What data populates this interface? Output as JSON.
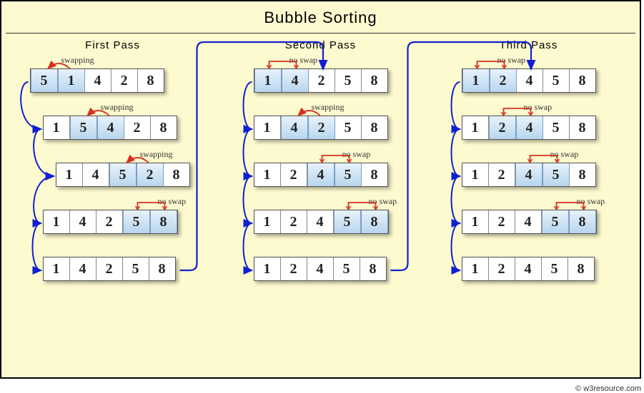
{
  "title": "Bubble  Sorting",
  "credit": "© w3resource.com",
  "passes": [
    {
      "label": "First  Pass",
      "rows": [
        {
          "values": [
            5,
            1,
            4,
            2,
            8
          ],
          "highlight": [
            0,
            1
          ],
          "annot": "swapping",
          "annotType": "swap",
          "indent": 0
        },
        {
          "values": [
            1,
            5,
            4,
            2,
            8
          ],
          "highlight": [
            1,
            2
          ],
          "annot": "swapping",
          "annotType": "swap",
          "indent": 1
        },
        {
          "values": [
            1,
            4,
            5,
            2,
            8
          ],
          "highlight": [
            2,
            3
          ],
          "annot": "swapping",
          "annotType": "swap",
          "indent": 2
        },
        {
          "values": [
            1,
            4,
            2,
            5,
            8
          ],
          "highlight": [
            3,
            4
          ],
          "annot": "no swap",
          "annotType": "noswap",
          "indent": 3
        },
        {
          "values": [
            1,
            4,
            2,
            5,
            8
          ],
          "highlight": [],
          "annot": "",
          "annotType": "none",
          "indent": 4
        }
      ]
    },
    {
      "label": "Second  Pass",
      "rows": [
        {
          "values": [
            1,
            4,
            2,
            5,
            8
          ],
          "highlight": [
            0,
            1
          ],
          "annot": "no swap",
          "annotType": "noswap"
        },
        {
          "values": [
            1,
            4,
            2,
            5,
            8
          ],
          "highlight": [
            1,
            2
          ],
          "annot": "swapping",
          "annotType": "swap"
        },
        {
          "values": [
            1,
            2,
            4,
            5,
            8
          ],
          "highlight": [
            2,
            3
          ],
          "annot": "no swap",
          "annotType": "noswap"
        },
        {
          "values": [
            1,
            2,
            4,
            5,
            8
          ],
          "highlight": [
            3,
            4
          ],
          "annot": "no swap",
          "annotType": "noswap"
        },
        {
          "values": [
            1,
            2,
            4,
            5,
            8
          ],
          "highlight": [],
          "annot": "",
          "annotType": "none"
        }
      ]
    },
    {
      "label": "Third  Pass",
      "rows": [
        {
          "values": [
            1,
            2,
            4,
            5,
            8
          ],
          "highlight": [
            0,
            1
          ],
          "annot": "no swap",
          "annotType": "noswap"
        },
        {
          "values": [
            1,
            2,
            4,
            5,
            8
          ],
          "highlight": [
            1,
            2
          ],
          "annot": "no swap",
          "annotType": "noswap"
        },
        {
          "values": [
            1,
            2,
            4,
            5,
            8
          ],
          "highlight": [
            2,
            3
          ],
          "annot": "no swap",
          "annotType": "noswap"
        },
        {
          "values": [
            1,
            2,
            4,
            5,
            8
          ],
          "highlight": [
            3,
            4
          ],
          "annot": "no swap",
          "annotType": "noswap"
        },
        {
          "values": [
            1,
            2,
            4,
            5,
            8
          ],
          "highlight": [],
          "annot": "",
          "annotType": "none"
        }
      ]
    }
  ],
  "colors": {
    "flowArrow": "#1020d0",
    "swapArrow": "#d83020",
    "noswapBracket": "#d83020"
  }
}
